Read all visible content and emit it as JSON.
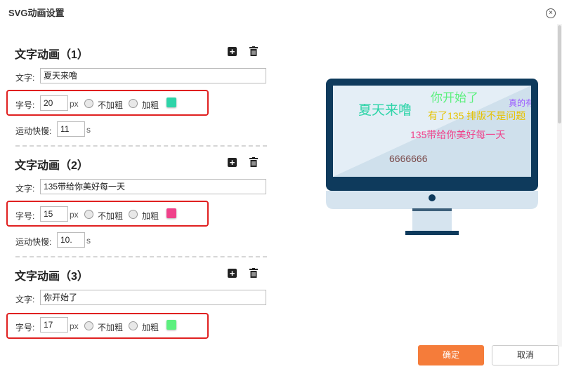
{
  "dialog": {
    "title": "SVG动画设置",
    "close_label": "⊗"
  },
  "sections": [
    {
      "title": "文字动画（1）",
      "text_label": "文字:",
      "text_value": "夏天来噜",
      "size_label": "字号:",
      "size_value": "20",
      "unit": "px",
      "normal_label": "不加粗",
      "bold_label": "加粗",
      "color": "#2dd4a8",
      "speed_label": "运动快慢:",
      "speed_value": "11",
      "speed_unit": "s"
    },
    {
      "title": "文字动画（2）",
      "text_label": "文字:",
      "text_value": "135带给你美好每一天",
      "size_label": "字号:",
      "size_value": "15",
      "unit": "px",
      "normal_label": "不加粗",
      "bold_label": "加粗",
      "color": "#f0418a",
      "speed_label": "运动快慢:",
      "speed_value": "10.",
      "speed_unit": "s"
    },
    {
      "title": "文字动画（3）",
      "text_label": "文字:",
      "text_value": "你开始了",
      "size_label": "字号:",
      "size_value": "17",
      "unit": "px",
      "normal_label": "不加粗",
      "bold_label": "加粗",
      "color": "#5cf07e"
    }
  ],
  "preview": {
    "texts": [
      {
        "text": "夏天来噜",
        "color": "#2dd4a8"
      },
      {
        "text": "你开始了",
        "color": "#5cf07e"
      },
      {
        "text": "真的有",
        "color": "#9b59ff"
      },
      {
        "text": "有了135 排版不是问题",
        "color": "#e6c200"
      },
      {
        "text": "135带给你美好每一天",
        "color": "#f0418a"
      },
      {
        "text": "6666666",
        "color": "#7a4a4a"
      }
    ]
  },
  "footer": {
    "ok_label": "确定",
    "cancel_label": "取消"
  },
  "colors": {
    "accent": "#f57c3a",
    "highlight": "#e02020",
    "monitor": "#0e3a5c"
  }
}
